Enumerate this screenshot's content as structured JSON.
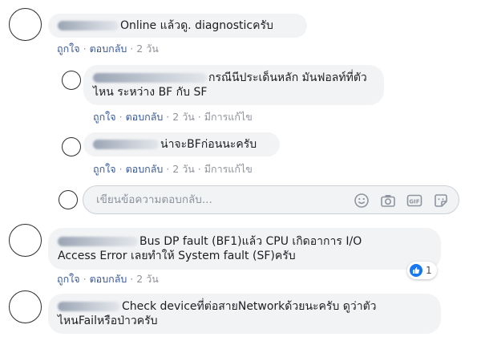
{
  "comments": [
    {
      "text": "Online แล้วดู. diagnosticครับ",
      "like": "ถูกใจ",
      "reply": "ตอบกลับ",
      "time": "2 วัน"
    },
    {
      "line1": "กรณีนีประเด็นหลัก มันฟอลท์ที่ตัว",
      "line2": "ไหน ระหว่าง BF กับ SF",
      "like": "ถูกใจ",
      "reply": "ตอบกลับ",
      "time": "2 วัน",
      "edited": "มีการแก้ไข"
    },
    {
      "text": "น่าจะBFก่อนนะครับ",
      "like": "ถูกใจ",
      "reply": "ตอบกลับ",
      "time": "2 วัน",
      "edited": "มีการแก้ไข"
    },
    {
      "line1": "Bus DP fault (BF1)แล้ว CPU เกิดอาการ I/O",
      "line2": "Access Error เลยทำให้ System fault (SF)ครับ",
      "like": "ถูกใจ",
      "reply": "ตอบกลับ",
      "time": "2 วัน",
      "reaction_count": "1"
    },
    {
      "line1": "Check deviceที่ต่อสายNetworkด้วยนะครับ ดูว่าตัว",
      "line2": "ไหนFailหรือป่าวครับ"
    }
  ],
  "reply_box": {
    "placeholder": "เขียนข้อความตอบกลับ..."
  },
  "icons": [
    "emoji-icon",
    "camera-icon",
    "gif-icon",
    "sticker-icon",
    "like-icon"
  ],
  "colors": {
    "link": "#385898",
    "bubble": "#f2f3f5",
    "meta": "#90949c",
    "like": "#1877f2"
  }
}
